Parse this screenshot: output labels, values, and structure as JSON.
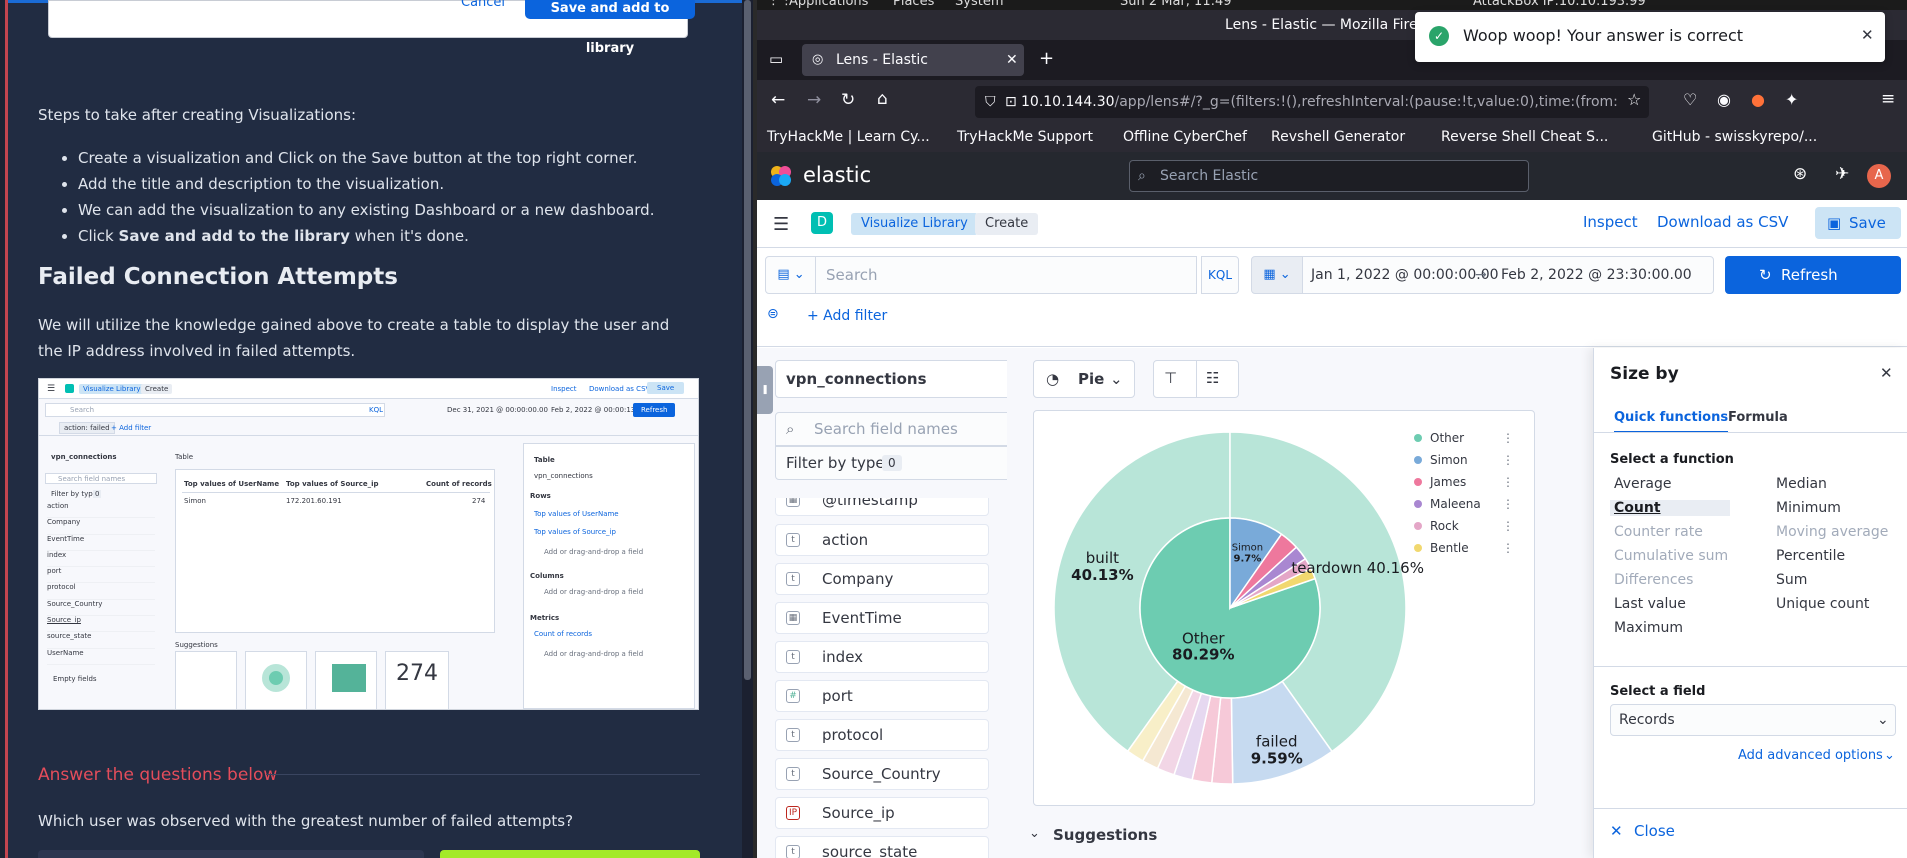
{
  "tutorial": {
    "modal_cancel": "Cancel",
    "modal_save": "Save and add to library",
    "steps_intro": "Steps to take after creating Visualizations:",
    "steps": [
      "Create a visualization and Click on the Save button at the top right corner.",
      "Add the title and description to the visualization.",
      "We can add the visualization to any existing Dashboard or a new dashboard."
    ],
    "step4_prefix": "Click ",
    "step4_bold": "Save and add to the library",
    "step4_suffix": " when it's done.",
    "heading": "Failed Connection Attempts",
    "para": "We will utilize the knowledge gained above to create a table to display the user and the IP address involved in failed attempts.",
    "answer_heading": "Answer the questions below",
    "question": "Which user was observed with the greatest number of failed attempts?"
  },
  "thumbnail": {
    "crumb1": "Visualize Library",
    "crumb2": "Create",
    "inspect": "Inspect",
    "download": "Download as CSV",
    "save": "Save",
    "search": "Search",
    "kql": "KQL",
    "date_from": "Dec 31, 2021 @ 00:00:00.00",
    "date_to": "Feb 2, 2022 @ 00:00:13.81",
    "refresh": "Refresh",
    "filter": "action: failed",
    "add_filter": "+ Add filter",
    "index": "vpn_connections",
    "search_fields": "Search field names",
    "filter_by_type": "Filter by type",
    "filter_count": "0",
    "fields": [
      "action",
      "Company",
      "EventTime",
      "index",
      "port",
      "protocol",
      "Source_Country",
      "Source_ip",
      "source_state",
      "UserName"
    ],
    "empty_fields": "Empty fields",
    "vis_type": "Table",
    "col1": "Top values of UserName",
    "col2": "Top values of Source_ip",
    "col3": "Count of records",
    "row_user": "Simon",
    "row_ip": "172.201.60.191",
    "row_count": "274",
    "suggestions": "Suggestions",
    "big_number": "274",
    "panel_title": "Table",
    "panel_index": "vpn_connections",
    "rows_label": "Rows",
    "row_dim1": "Top values of UserName",
    "row_dim2": "Top values of Source_ip",
    "add_field": "Add or drag-and-drop a field",
    "columns_label": "Columns",
    "metrics_label": "Metrics",
    "metric1": "Count of records"
  },
  "gnome": {
    "applications": "Applications",
    "places": "Places",
    "system": "System",
    "clock": "Sun 2 Mar, 11:49",
    "attackbox": "AttackBox IP:10.10.193.99"
  },
  "browser": {
    "title": "Lens - Elastic — Mozilla Firefox",
    "tab_title": "Lens - Elastic",
    "url_host": "10.10.144.30",
    "url_rest": "/app/lens#/?_g=(filters:!(),refreshInterval:(pause:!t,value:0),time:(from:",
    "bookmarks": [
      "TryHackMe | Learn Cy...",
      "TryHackMe Support",
      "Offline CyberChef",
      "Revshell Generator",
      "Reverse Shell Cheat S...",
      "GitHub - swisskyrepo/..."
    ]
  },
  "kibana": {
    "brand": "elastic",
    "search_placeholder": "Search Elastic",
    "avatar": "A",
    "space": "D",
    "crumb1": "Visualize Library",
    "crumb2": "Create",
    "inspect": "Inspect",
    "download": "Download as CSV",
    "save": "Save",
    "query_placeholder": "Search",
    "kql": "KQL",
    "date_from": "Jan 1, 2022 @ 00:00:00.00",
    "date_to": "Feb 2, 2022 @ 23:30:00.00",
    "refresh": "Refresh",
    "add_filter": "+ Add filter",
    "index": "vpn_connections",
    "field_search_placeholder": "Search field names",
    "filter_by_type": "Filter by type",
    "filter_count": "0",
    "fields": [
      {
        "name": "@timestamp",
        "type": "date"
      },
      {
        "name": "action",
        "type": "t"
      },
      {
        "name": "Company",
        "type": "t"
      },
      {
        "name": "EventTime",
        "type": "date"
      },
      {
        "name": "index",
        "type": "t"
      },
      {
        "name": "port",
        "type": "#"
      },
      {
        "name": "protocol",
        "type": "t"
      },
      {
        "name": "Source_Country",
        "type": "t"
      },
      {
        "name": "Source_ip",
        "type": "ip"
      },
      {
        "name": "source_state",
        "type": "t"
      }
    ],
    "vis_type": "Pie",
    "suggestions": "Suggestions"
  },
  "chart_data": {
    "type": "pie",
    "inner_ring": [
      {
        "label": "Other",
        "percent": 80.29,
        "label_shown": "80.29%",
        "color": "#6dccb1"
      },
      {
        "label": "Simon",
        "percent": 9.7,
        "label_shown": "9.7%",
        "color": "#79aad9"
      },
      {
        "label": "James",
        "percent": 3.5,
        "color": "#ee789d"
      },
      {
        "label": "Maleena",
        "percent": 2.6,
        "color": "#a987d1"
      },
      {
        "label": "Rock",
        "percent": 2.0,
        "color": "#e4a6c7"
      },
      {
        "label": "Bentle",
        "percent": 1.91,
        "color": "#f1d86f"
      }
    ],
    "outer_ring": [
      {
        "label": "built",
        "percent": 40.13,
        "label_shown": "40.13%",
        "color": "#b8e5d8"
      },
      {
        "label": "teardown",
        "percent": 40.16,
        "label_shown": "40.16%",
        "color": "#b8e5d8"
      },
      {
        "label": "failed",
        "percent": 9.59,
        "label_shown": "9.59%",
        "color": "#c6daf0"
      },
      {
        "label": "",
        "percent": 1.9,
        "color": "#f6c9d8"
      },
      {
        "label": "",
        "percent": 1.8,
        "color": "#f6c9d8"
      },
      {
        "label": "",
        "percent": 1.7,
        "color": "#e6d8f0"
      },
      {
        "label": "",
        "percent": 1.6,
        "color": "#f2d6e6"
      },
      {
        "label": "",
        "percent": 1.5,
        "color": "#f5e8d2"
      },
      {
        "label": "",
        "percent": 1.61,
        "color": "#f8efc8"
      }
    ],
    "legend": [
      {
        "name": "Other",
        "color": "#6dccb1"
      },
      {
        "name": "Simon",
        "color": "#79aad9"
      },
      {
        "name": "James",
        "color": "#ee789d"
      },
      {
        "name": "Maleena",
        "color": "#a987d1"
      },
      {
        "name": "Rock",
        "color": "#e4a6c7"
      },
      {
        "name": "Bentle",
        "color": "#f1d86f"
      }
    ],
    "legend_position": "top-right"
  },
  "flyout": {
    "title": "Size by",
    "tab1": "Quick functions",
    "tab2": "Formula",
    "select_function": "Select a function",
    "functions_col1": [
      "Average",
      "Count",
      "Counter rate",
      "Cumulative sum",
      "Differences",
      "Last value",
      "Maximum"
    ],
    "functions_col2": [
      "Median",
      "Minimum",
      "Moving average",
      "Percentile",
      "Sum",
      "Unique count"
    ],
    "select_field": "Select a field",
    "field_value": "Records",
    "advanced": "Add advanced options",
    "close": "Close"
  },
  "toast": {
    "message": "Woop woop! Your answer is correct"
  }
}
